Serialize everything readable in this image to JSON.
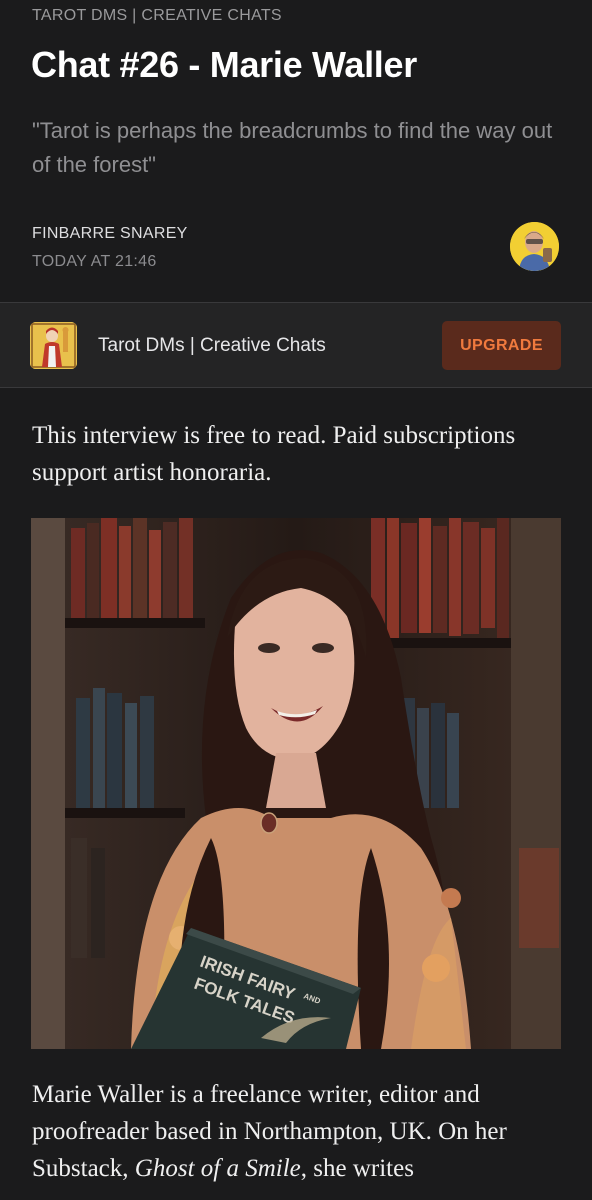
{
  "post": {
    "kicker": "TAROT DMS | CREATIVE CHATS",
    "title": "Chat #26 - Marie Waller",
    "subtitle": "\"Tarot is perhaps the breadcrumbs to find the way out of the forest\""
  },
  "author": {
    "name": "FINBARRE SNAREY",
    "date": "TODAY AT 21:46"
  },
  "publication": {
    "name": "Tarot DMs | Creative Chats",
    "upgrade_label": "UPGRADE"
  },
  "content": {
    "intro": "This interview is free to read. Paid subscriptions support artist honoraria.",
    "photo_book_title_line1": "IRISH FAIRY",
    "photo_book_title_and": "AND",
    "photo_book_title_line2": "FOLK TALES",
    "bio_before": "Marie Waller is a freelance writer, editor and proofreader based in Northampton, UK. On her Substack, ",
    "bio_emphasis": "Ghost of a Smile",
    "bio_after": ", she writes"
  },
  "icons": {
    "author_avatar": "author-avatar-image",
    "publication_logo": "tarot-card-logo"
  },
  "colors": {
    "background": "#1b1b1c",
    "upgrade_text": "#f07a3e",
    "upgrade_background": "#5a2a1c"
  }
}
